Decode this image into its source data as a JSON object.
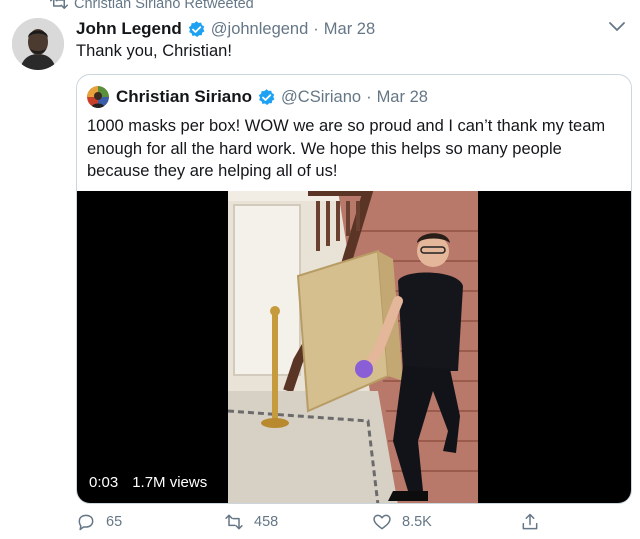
{
  "retweet": {
    "text": "Christian Siriano Retweeted",
    "icon": "retweet-icon"
  },
  "tweet": {
    "author_name": "John Legend",
    "handle": "@johnlegend",
    "separator": "·",
    "date": "Mar 28",
    "text": "Thank you, Christian!",
    "verified": true
  },
  "quoted_tweet": {
    "author_name": "Christian Siriano",
    "handle": "@CSiriano",
    "separator": "·",
    "date": "Mar 28",
    "text": "1000 masks per box! WOW we are so proud and I can’t thank my team enough for all the hard work. We hope this helps so many people because they are helping all of us!",
    "verified": true,
    "video": {
      "duration": "0:03",
      "views": "1.7M views"
    }
  },
  "actions": {
    "replies": "65",
    "retweets": "458",
    "likes": "8.5K"
  },
  "colors": {
    "text": "#14171a",
    "secondary": "#657786",
    "verified": "#1da1f2",
    "border": "#ccd6dd"
  }
}
